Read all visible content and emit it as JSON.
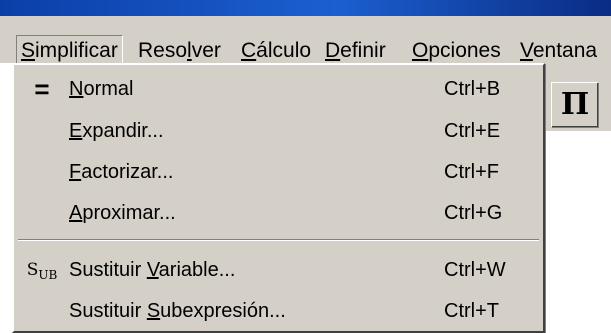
{
  "menubar": {
    "items": [
      {
        "pre": "",
        "mnemonic": "S",
        "post": "implificar"
      },
      {
        "pre": "Reso",
        "mnemonic": "l",
        "post": "ver"
      },
      {
        "pre": "",
        "mnemonic": "C",
        "post": "álculo"
      },
      {
        "pre": "",
        "mnemonic": "D",
        "post": "efinir"
      },
      {
        "pre": "",
        "mnemonic": "O",
        "post": "pciones"
      },
      {
        "pre": "",
        "mnemonic": "V",
        "post": "entana"
      }
    ]
  },
  "toolbar": {
    "pi_label": "Π"
  },
  "dropdown": {
    "items": [
      {
        "icon": "equals-icon",
        "icon_text": "=",
        "pre": "",
        "mnemonic": "N",
        "post": "ormal",
        "shortcut": "Ctrl+B"
      },
      {
        "icon": "",
        "icon_text": "",
        "pre": "",
        "mnemonic": "E",
        "post": "xpandir...",
        "shortcut": "Ctrl+E"
      },
      {
        "icon": "",
        "icon_text": "",
        "pre": "",
        "mnemonic": "F",
        "post": "actorizar...",
        "shortcut": "Ctrl+F"
      },
      {
        "icon": "",
        "icon_text": "",
        "pre": "",
        "mnemonic": "A",
        "post": "proximar...",
        "shortcut": "Ctrl+G"
      },
      {
        "icon": "substitute-variable-icon",
        "icon_text": "SUB",
        "pre": "Sustituir ",
        "mnemonic": "V",
        "post": "ariable...",
        "shortcut": "Ctrl+W"
      },
      {
        "icon": "",
        "icon_text": "",
        "pre": "Sustituir ",
        "mnemonic": "S",
        "post": "ubexpresión...",
        "shortcut": "Ctrl+T"
      }
    ]
  }
}
